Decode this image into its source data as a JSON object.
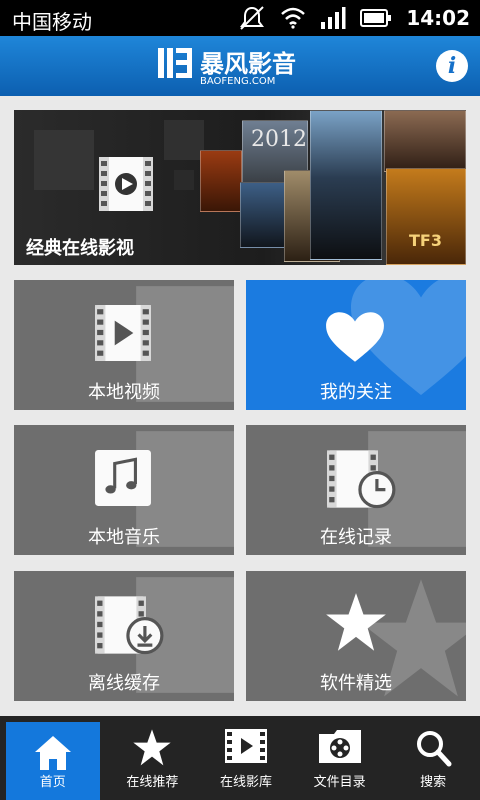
{
  "status_bar": {
    "carrier": "中国移动",
    "time": "14:02",
    "icons": [
      "silent-icon",
      "wifi-icon",
      "signal-icon",
      "battery-icon"
    ]
  },
  "header": {
    "logo_text": "暴风影音",
    "logo_subtext": "BAOFENG.COM",
    "info_label": "i"
  },
  "banner": {
    "label": "经典在线影视",
    "poster_titles": [
      "2012",
      "TF3"
    ]
  },
  "tiles": [
    {
      "label": "本地视频",
      "icon": "film-play-icon"
    },
    {
      "label": "我的关注",
      "icon": "heart-icon"
    },
    {
      "label": "本地音乐",
      "icon": "music-note-icon"
    },
    {
      "label": "在线记录",
      "icon": "film-clock-icon"
    },
    {
      "label": "离线缓存",
      "icon": "film-download-icon"
    },
    {
      "label": "软件精选",
      "icon": "star-icon"
    }
  ],
  "bottom_nav": [
    {
      "label": "首页",
      "icon": "home-icon",
      "active": true
    },
    {
      "label": "在线推荐",
      "icon": "star-icon"
    },
    {
      "label": "在线影库",
      "icon": "film-play-icon"
    },
    {
      "label": "文件目录",
      "icon": "folder-reel-icon"
    },
    {
      "label": "搜索",
      "icon": "search-icon"
    }
  ],
  "colors": {
    "header_blue": "#1570c9",
    "tile_gray": "#6e6e6e",
    "tile_blue": "#1b7be0",
    "nav_bg": "#242424",
    "nav_active": "#1478dc"
  }
}
